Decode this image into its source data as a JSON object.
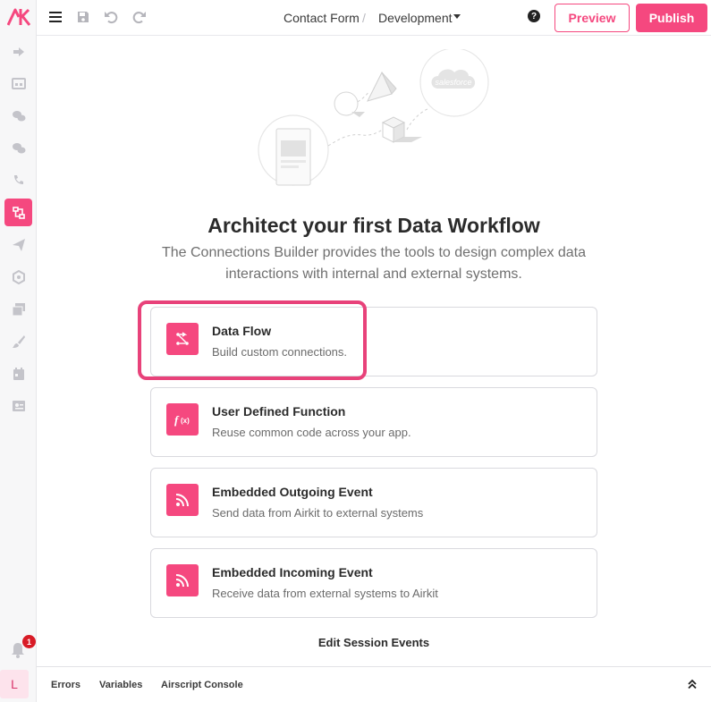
{
  "sidebar": {
    "logo": "AK",
    "icons": [
      "arrow-right-icon",
      "browser-grid-icon",
      "chat-bubbles-icon",
      "chat-bubbles-alt-icon",
      "phone-call-icon",
      "connections-builder-icon",
      "send-icon",
      "cube-icon",
      "media-library-icon",
      "brush-icon",
      "calendar-icon",
      "contact-card-icon"
    ],
    "active_index": 5,
    "notification_count": "1",
    "user_initial": "L"
  },
  "topbar": {
    "app_title": "Contact Form",
    "separator": "/",
    "environment": "Development",
    "help": "?",
    "preview_label": "Preview",
    "publish_label": "Publish"
  },
  "main": {
    "heading": "Architect your first Data Workflow",
    "subtext": "The Connections Builder provides the tools to design complex data interactions with internal and external systems.",
    "illustration_brand": "salesforce",
    "cards": [
      {
        "title": "Data Flow",
        "description": "Build custom connections.",
        "icon": "data-flow-icon"
      },
      {
        "title": "User Defined Function",
        "description": "Reuse common code across your app.",
        "icon": "function-icon"
      },
      {
        "title": "Embedded Outgoing Event",
        "description": "Send data from Airkit to external systems",
        "icon": "rss-icon"
      },
      {
        "title": "Embedded Incoming Event",
        "description": "Receive data from external systems to Airkit",
        "icon": "rss-icon"
      }
    ],
    "edit_session_label": "Edit Session Events"
  },
  "bottombar": {
    "tabs": [
      "Errors",
      "Variables",
      "Airscript Console"
    ]
  },
  "colors": {
    "accent": "#f5487f",
    "badge": "#d81b26"
  }
}
